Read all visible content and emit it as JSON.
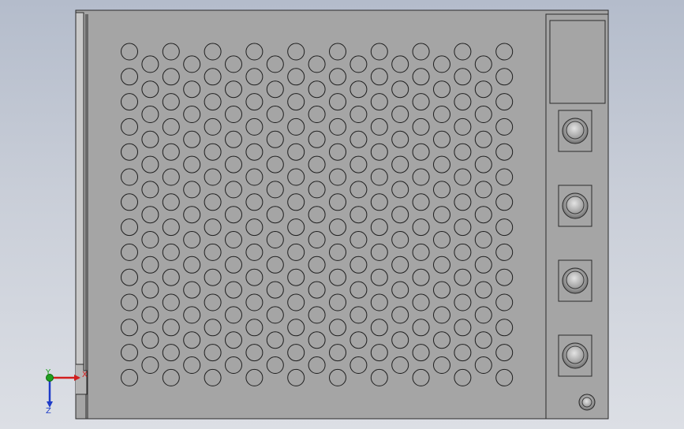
{
  "app": {
    "view": "cad-model-front-view"
  },
  "model": {
    "name": "perforated-enclosure-panel",
    "colors": {
      "background_top": "#b4bccb",
      "background_bottom": "#dcdfe5",
      "panel_face": "#a5a5a5",
      "edge": "#2a2a2a",
      "hole_stroke": "#1e1e1e",
      "side_rail": "#c9c9c9"
    },
    "vent_pattern": {
      "long_rows": 14,
      "long_row_count": 19,
      "short_rows": 13,
      "short_row_count": 18
    },
    "connectors": [
      {
        "name": "connector-1"
      },
      {
        "name": "connector-2"
      },
      {
        "name": "connector-3"
      },
      {
        "name": "connector-4"
      }
    ],
    "small_knob": {
      "name": "small-knob"
    },
    "label_window": {
      "name": "label-window"
    }
  },
  "triad": {
    "x_label": "X",
    "y_label": "Y",
    "z_label": "Z",
    "colors": {
      "x": "#d21e1e",
      "y": "#1fa01f",
      "z": "#1e3cc8"
    }
  }
}
